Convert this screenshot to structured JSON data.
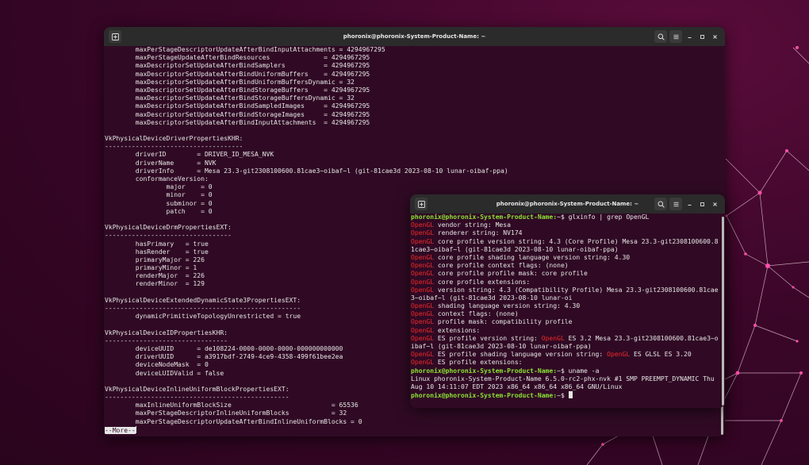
{
  "desktop": {
    "background": "#3b0629",
    "network_color": "#e0458f"
  },
  "window_main": {
    "title": "phoronix@phoronix-System-Product-Name: ~",
    "lines": [
      "        maxPerStageDescriptorUpdateAfterBindInputAttachments = 4294967295",
      "        maxPerStageUpdateAfterBindResources              = 4294967295",
      "        maxDescriptorSetUpdateAfterBindSamplers          = 4294967295",
      "        maxDescriptorSetUpdateAfterBindUniformBuffers    = 4294967295",
      "        maxDescriptorSetUpdateAfterBindUniformBuffersDynamic = 32",
      "        maxDescriptorSetUpdateAfterBindStorageBuffers    = 4294967295",
      "        maxDescriptorSetUpdateAfterBindStorageBuffersDynamic = 32",
      "        maxDescriptorSetUpdateAfterBindSampledImages     = 4294967295",
      "        maxDescriptorSetUpdateAfterBindStorageImages     = 4294967295",
      "        maxDescriptorSetUpdateAfterBindInputAttachments  = 4294967295",
      "",
      "VkPhysicalDeviceDriverPropertiesKHR:",
      "------------------------------------",
      "        driverID        = DRIVER_ID_MESA_NVK",
      "        driverName      = NVK",
      "        driverInfo      = Mesa 23.3-git2308100600.81cae3~oibaf~l (git-81cae3d 2023-08-10 lunar-oibaf-ppa)",
      "        conformanceVersion:",
      "                major    = 0",
      "                minor    = 0",
      "                subminor = 0",
      "                patch    = 0",
      "",
      "VkPhysicalDeviceDrmPropertiesEXT:",
      "---------------------------------",
      "        hasPrimary   = true",
      "        hasRender    = true",
      "        primaryMajor = 226",
      "        primaryMinor = 1",
      "        renderMajor  = 226",
      "        renderMinor  = 129",
      "",
      "VkPhysicalDeviceExtendedDynamicState3PropertiesEXT:",
      "---------------------------------------------------",
      "        dynamicPrimitiveTopologyUnrestricted = true",
      "",
      "VkPhysicalDeviceIDPropertiesKHR:",
      "--------------------------------",
      "        deviceUUID      = de108224-0000-0000-0000-000000000000",
      "        driverUUID      = a3917bdf-2749-4ce9-4358-499f61bee2ea",
      "        deviceNodeMask  = 0",
      "        deviceLUIDValid = false",
      "",
      "VkPhysicalDeviceInlineUniformBlockPropertiesEXT:",
      "------------------------------------------------",
      "        maxInlineUniformBlockSize                          = 65536",
      "        maxPerStageDescriptorInlineUniformBlocks           = 32",
      "        maxPerStageDescriptorUpdateAfterBindInlineUniformBlocks = 0"
    ],
    "more_prompt": "--More--"
  },
  "window_glx": {
    "title": "phoronix@phoronix-System-Product-Name: ~",
    "prompt": "phoronix@phoronix-System-Product-Name:",
    "prompt_suffix": "~$ ",
    "command1": "glxinfo | grep OpenGL",
    "keyword": "OpenGL",
    "output1": [
      [
        " vendor string: Mesa"
      ],
      [
        " renderer string: NV174"
      ],
      [
        " core profile version string: 4.3 (Core Profile) Mesa 23.3-git2308100600.8"
      ],
      [
        "1cae3~oibaf~l (git-81cae3d 2023-08-10 lunar-oibaf-ppa)",
        "nokw"
      ],
      [
        " core profile shading language version string: 4.30"
      ],
      [
        " core profile context flags: (none)"
      ],
      [
        " core profile profile mask: core profile"
      ],
      [
        " core profile extensions:"
      ],
      [
        " version string: 4.3 (Compatibility Profile) Mesa 23.3-git2308100600.81cae"
      ],
      [
        "3~oibaf~l (git-81cae3d 2023-08-10 lunar-oi",
        "nokw"
      ],
      [
        " shading language version string: 4.30"
      ],
      [
        " context flags: (none)"
      ],
      [
        " profile mask: compatibility profile"
      ],
      [
        " extensions:"
      ],
      [
        " ES profile version string: ",
        "mid",
        " ES 3.2 Mesa 23.3-git2308100600.81cae3~o"
      ],
      [
        "ibaf~l (git-81cae3d 2023-08-10 lunar-oibaf-ppa)",
        "nokw"
      ],
      [
        " ES profile shading language version string: ",
        "mid",
        " ES GLSL ES 3.20"
      ],
      [
        " ES profile extensions:"
      ]
    ],
    "command2": "uname -a",
    "output2": [
      "Linux phoronix-System-Product-Name 6.5.0-rc2-phx-nvk #1 SMP PREEMPT_DYNAMIC Thu",
      "Aug 10 14:11:07 EDT 2023 x86_64 x86_64 x86_64 GNU/Linux"
    ]
  },
  "icons": {
    "new_tab": "new-tab-icon",
    "search": "search-icon",
    "menu": "hamburger-menu-icon",
    "minimize": "minimize-icon",
    "maximize": "maximize-icon",
    "close": "close-icon"
  }
}
